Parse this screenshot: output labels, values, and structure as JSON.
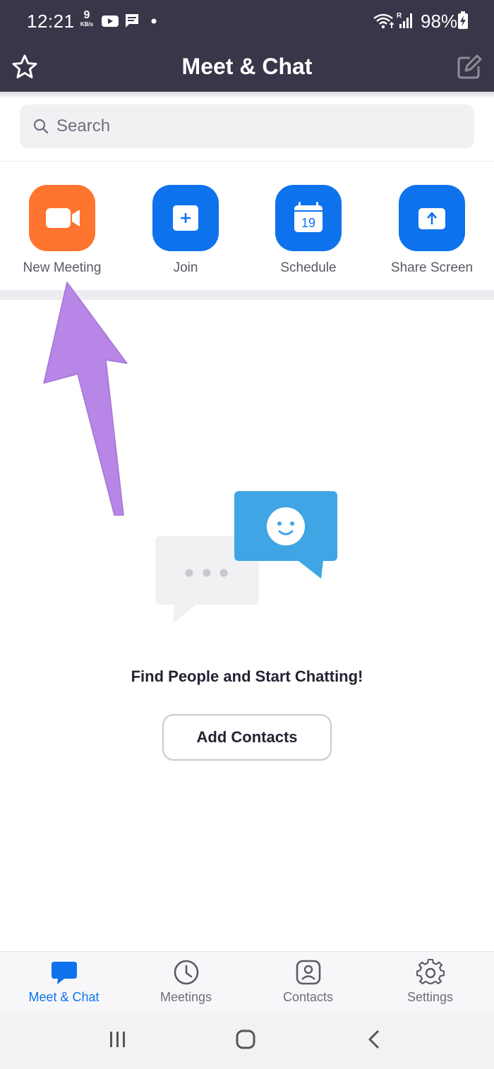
{
  "status_bar": {
    "time": "12:21",
    "net_speed_value": "9",
    "net_speed_unit": "KB/s",
    "battery": "98%",
    "icons": [
      "youtube-icon",
      "message-icon",
      "dot-icon",
      "wifi-icon",
      "signal-icon",
      "battery-charging-icon"
    ]
  },
  "header": {
    "title": "Meet & Chat",
    "left_icon": "star-icon",
    "right_icon": "compose-icon"
  },
  "search": {
    "placeholder": "Search"
  },
  "actions": [
    {
      "label": "New Meeting",
      "icon": "video-camera-icon",
      "color": "#ff742e"
    },
    {
      "label": "Join",
      "icon": "plus-icon",
      "color": "#0e72ed"
    },
    {
      "label": "Schedule",
      "icon": "calendar-icon",
      "calendar_day": "19",
      "color": "#0e72ed"
    },
    {
      "label": "Share Screen",
      "icon": "share-screen-icon",
      "color": "#0e72ed"
    }
  ],
  "empty_state": {
    "title": "Find People and Start Chatting!",
    "button_label": "Add Contacts"
  },
  "tabs": [
    {
      "label": "Meet & Chat",
      "icon": "chat-bubble-icon",
      "active": true
    },
    {
      "label": "Meetings",
      "icon": "clock-icon",
      "active": false
    },
    {
      "label": "Contacts",
      "icon": "contact-icon",
      "active": false
    },
    {
      "label": "Settings",
      "icon": "gear-icon",
      "active": false
    }
  ],
  "colors": {
    "header_bg": "#3a3649",
    "accent_blue": "#0e72ed",
    "accent_orange": "#ff742e",
    "annotation_arrow": "#b886e6"
  }
}
